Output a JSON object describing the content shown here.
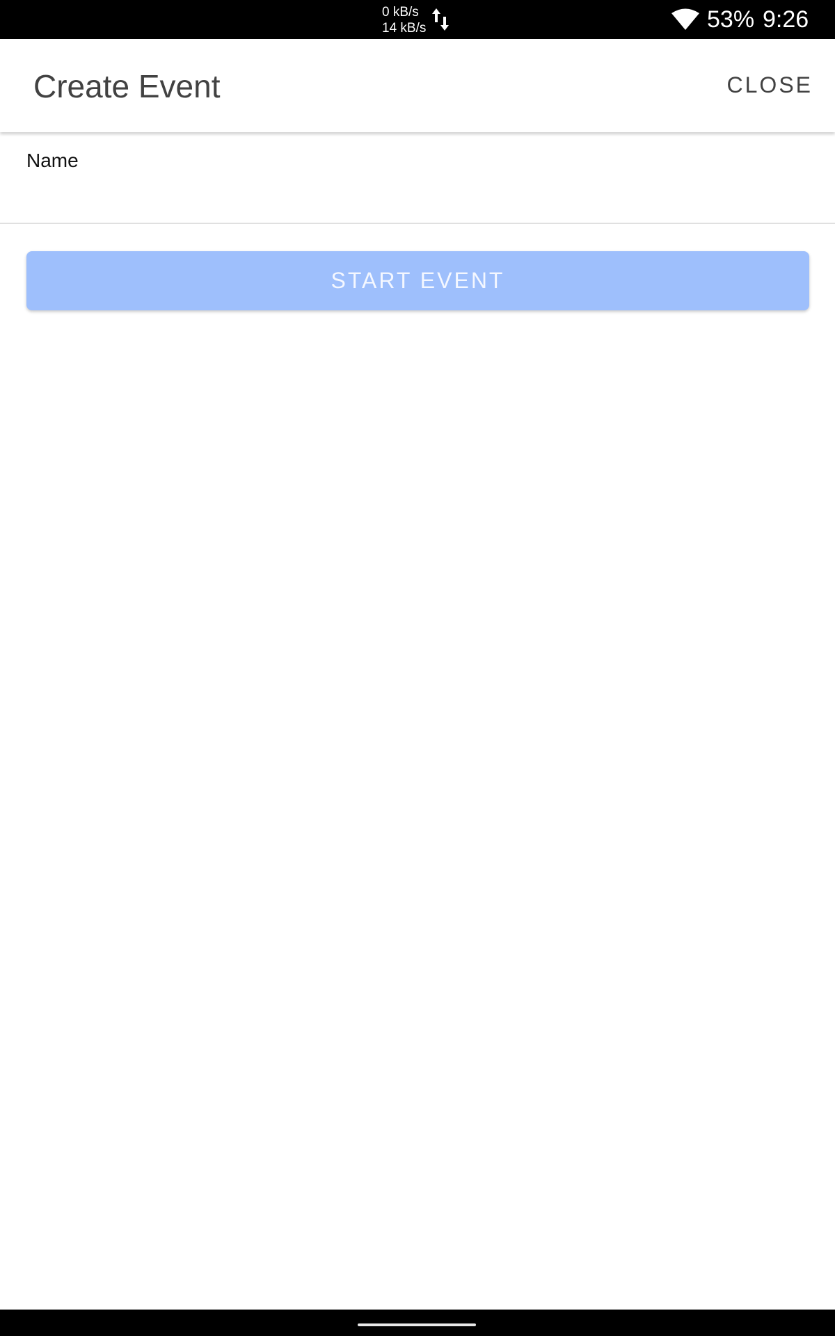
{
  "status_bar": {
    "upload_speed": "0 kB/s",
    "download_speed": "14 kB/s",
    "battery": "53%",
    "time": "9:26",
    "icons": [
      "updown-arrows-icon",
      "wifi-icon"
    ]
  },
  "app_bar": {
    "title": "Create Event",
    "close_label": "CLOSE"
  },
  "form": {
    "name_label": "Name",
    "name_value": "",
    "submit_label": "START EVENT"
  },
  "colors": {
    "status_bar_bg": "#000000",
    "app_bg": "#ffffff",
    "title_text": "#424242",
    "button_disabled_bg": "#9ebffc",
    "button_text": "#f4f7ff",
    "divider": "#e0e0e0"
  }
}
